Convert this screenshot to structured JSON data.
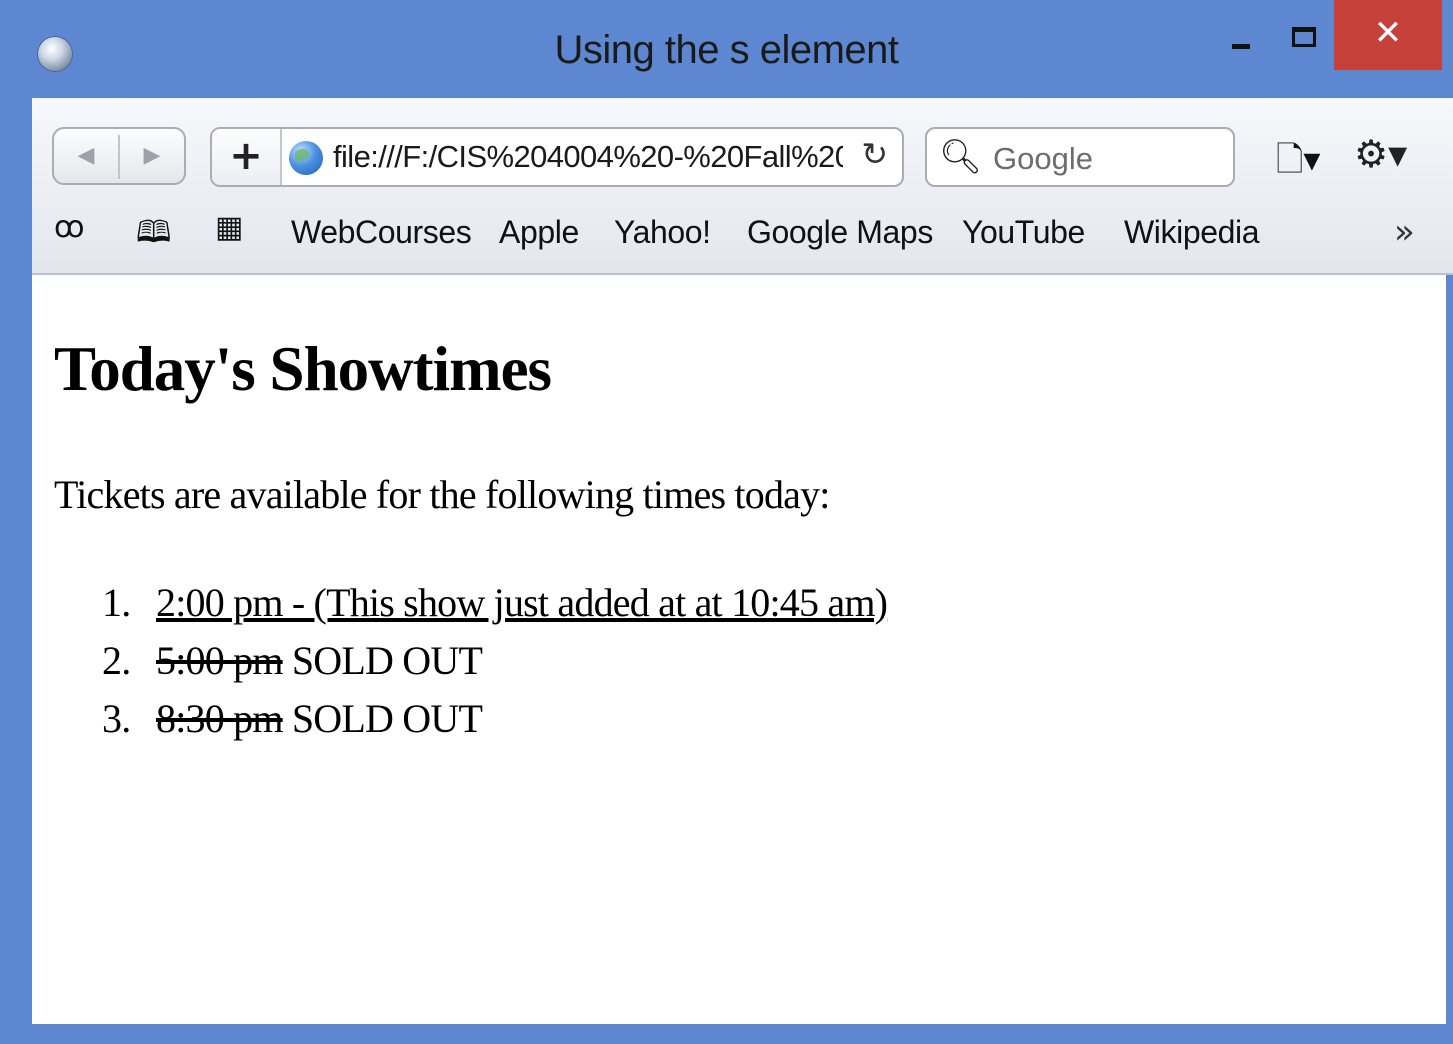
{
  "window": {
    "title": "Using the s element",
    "close_label": "✕"
  },
  "toolbar": {
    "back_label": "◀",
    "forward_label": "▶",
    "add_label": "+",
    "url": "file:///F:/CIS%204004%20-%20Fall%20",
    "search_placeholder": "Google"
  },
  "bookmarks": {
    "items": [
      "WebCourses",
      "Apple",
      "Yahoo!",
      "Google Maps",
      "YouTube",
      "Wikipedia"
    ],
    "more_label": "»"
  },
  "page": {
    "heading": "Today's Showtimes",
    "intro": "Tickets are available for the following times today:",
    "showtimes": [
      {
        "number": "1.",
        "text": "2:00 pm - (This show just added at at 10:45 am)"
      },
      {
        "number": "2.",
        "time": "5:00 pm",
        "status": " SOLD OUT"
      },
      {
        "number": "3.",
        "time": "8:30 pm",
        "status": " SOLD OUT"
      }
    ]
  }
}
